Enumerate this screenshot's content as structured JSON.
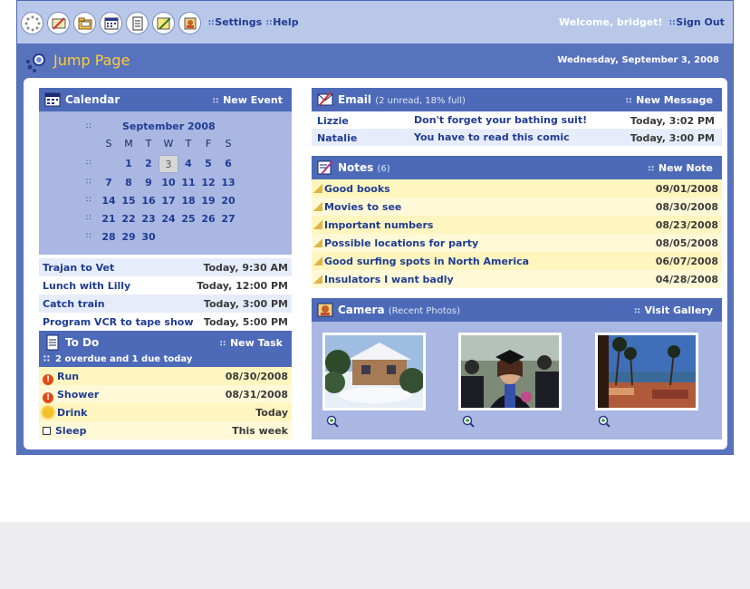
{
  "topbar": {
    "icons": [
      "loading-icon",
      "pencil-icon",
      "folder-icon",
      "calendar-icon",
      "notepad-icon",
      "notes-icon",
      "camera-icon"
    ],
    "settings_label": "Settings",
    "help_label": "Help",
    "welcome_text": "Welcome, bridget!",
    "signout_label": "Sign Out"
  },
  "page": {
    "title": "Jump Page",
    "date": "Wednesday, September 3, 2008"
  },
  "calendar": {
    "title": "Calendar",
    "new_event_label": "New Event",
    "month": "September 2008",
    "dow": [
      "S",
      "M",
      "T",
      "W",
      "T",
      "F",
      "S"
    ],
    "weeks": [
      [
        "",
        "1",
        "2",
        "3",
        "4",
        "5",
        "6"
      ],
      [
        "7",
        "8",
        "9",
        "10",
        "11",
        "12",
        "13"
      ],
      [
        "14",
        "15",
        "16",
        "17",
        "18",
        "19",
        "20"
      ],
      [
        "21",
        "22",
        "23",
        "24",
        "25",
        "26",
        "27"
      ],
      [
        "28",
        "29",
        "30",
        "",
        "",
        "",
        ""
      ]
    ],
    "today": "3",
    "events": [
      {
        "name": "Trajan to Vet",
        "time": "Today, 9:30 AM"
      },
      {
        "name": "Lunch with Lilly",
        "time": "Today, 12:00 PM"
      },
      {
        "name": "Catch train",
        "time": "Today, 3:00 PM"
      },
      {
        "name": "Program VCR to tape show",
        "time": "Today, 5:00 PM"
      }
    ]
  },
  "todo": {
    "title": "To Do",
    "new_task_label": "New Task",
    "summary": "2 overdue and 1 due today",
    "tasks": [
      {
        "name": "Run",
        "due": "08/30/2008",
        "status": "overdue"
      },
      {
        "name": "Shower",
        "due": "08/31/2008",
        "status": "overdue"
      },
      {
        "name": "Drink",
        "due": "Today",
        "status": "today"
      },
      {
        "name": "Sleep",
        "due": "This week",
        "status": "pending"
      }
    ]
  },
  "email": {
    "title": "Email",
    "subtitle": "(2 unread, 18% full)",
    "new_message_label": "New Message",
    "messages": [
      {
        "from": "Lizzie",
        "subject": "Don't forget your bathing suit!",
        "time": "Today, 3:02 PM"
      },
      {
        "from": "Natalie",
        "subject": "You have to read this comic",
        "time": "Today, 3:00 PM"
      }
    ]
  },
  "notes": {
    "title": "Notes",
    "count": "(6)",
    "new_note_label": "New Note",
    "items": [
      {
        "title": "Good books",
        "date": "09/01/2008"
      },
      {
        "title": "Movies to see",
        "date": "08/30/2008"
      },
      {
        "title": "Important numbers",
        "date": "08/23/2008"
      },
      {
        "title": "Possible locations for party",
        "date": "08/05/2008"
      },
      {
        "title": "Good surfing spots in North America",
        "date": "06/07/2008"
      },
      {
        "title": "Insulators I want badly",
        "date": "04/28/2008"
      }
    ]
  },
  "camera": {
    "title": "Camera",
    "subtitle": "(Recent Photos)",
    "visit_gallery_label": "Visit Gallery",
    "photos": [
      "snowy-house-photo",
      "graduation-photo",
      "palm-beach-photo"
    ]
  },
  "colors": {
    "header_blue": "#4d6ab9",
    "frame_blue": "#5873be",
    "panel_light_blue": "#a9b7e2",
    "accent_yellow": "#ffcc33",
    "row_yellow": "#fff5be"
  }
}
